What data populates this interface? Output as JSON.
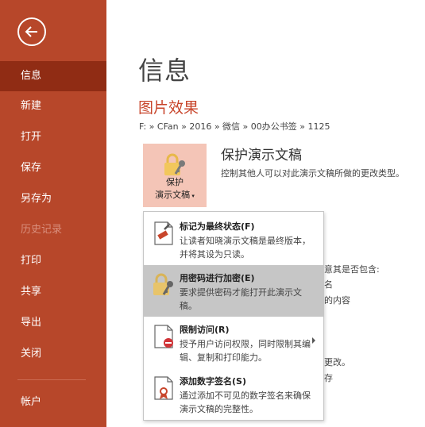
{
  "sidebar": {
    "items": [
      {
        "label": "信息"
      },
      {
        "label": "新建"
      },
      {
        "label": "打开"
      },
      {
        "label": "保存"
      },
      {
        "label": "另存为"
      },
      {
        "label": "历史记录"
      },
      {
        "label": "打印"
      },
      {
        "label": "共享"
      },
      {
        "label": "导出"
      },
      {
        "label": "关闭"
      },
      {
        "label": "帐户"
      }
    ]
  },
  "main": {
    "title": "信息",
    "doc_title": "图片效果",
    "breadcrumb": "F: » CFan » 2016 » 微信 » 00办公书签 » 1125",
    "protect": {
      "button_line1": "保护",
      "button_line2": "演示文稿",
      "heading": "保护演示文稿",
      "description": "控制其他人可以对此演示文稿所做的更改类型。"
    },
    "background_fragments": [
      "意其是否包含:",
      "名",
      "的内容",
      "更改。",
      "存"
    ]
  },
  "protect_menu": {
    "items": [
      {
        "title": "标记为最终状态(F)",
        "description": "让读者知晓演示文稿是最终版本，并将其设为只读。"
      },
      {
        "title": "用密码进行加密(E)",
        "description": "要求提供密码才能打开此演示文稿。"
      },
      {
        "title": "限制访问(R)",
        "description": "授予用户访问权限，同时限制其编辑、复制和打印能力。"
      },
      {
        "title": "添加数字签名(S)",
        "description": "通过添加不可见的数字签名来确保演示文稿的完整性。"
      }
    ]
  },
  "colors": {
    "sidebar_bg": "#b7472a",
    "sidebar_active": "#902c14",
    "accent_text": "#c8452b",
    "menu_highlight": "#c6c6c6"
  }
}
